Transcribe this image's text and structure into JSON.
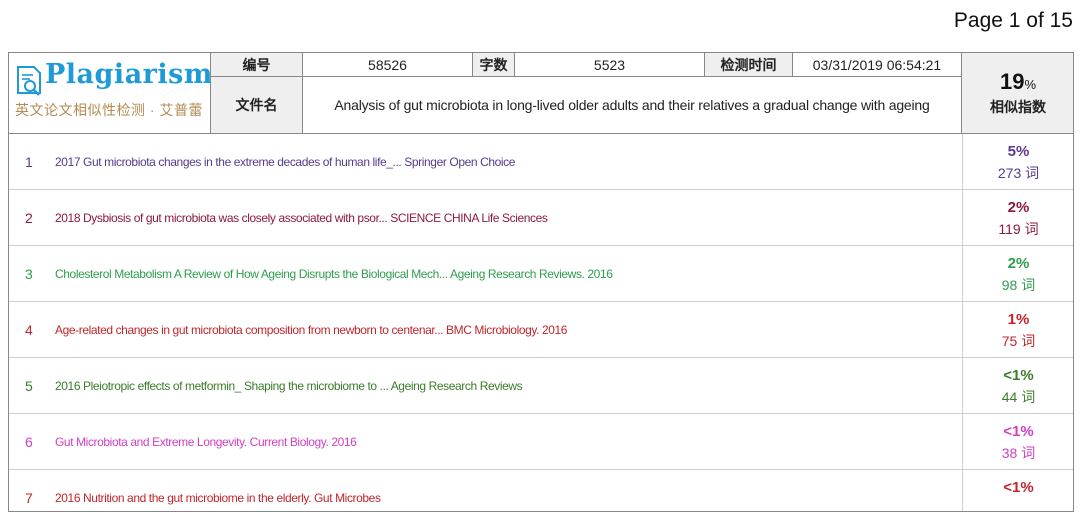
{
  "page_label": "Page 1 of 15",
  "logo": {
    "title": "Plagiarism",
    "subtitle": "英文论文相似性检测 · 艾普蕾"
  },
  "header": {
    "id_label": "编号",
    "id_value": "58526",
    "words_label": "字数",
    "words_value": "5523",
    "time_label": "检测时间",
    "time_value": "03/31/2019 06:54:21",
    "file_label": "文件名",
    "file_value": "Analysis of gut microbiota in long-lived older adults and their relatives a gradual change with ageing",
    "score_value": "19",
    "score_unit": "%",
    "score_label": "相似指数"
  },
  "results": [
    {
      "rank": "1",
      "title": "2017 Gut microbiota changes in the extreme decades of human life_... Springer Open Choice",
      "percent": "5%",
      "words": "273 词",
      "color": "#5a3a8c"
    },
    {
      "rank": "2",
      "title": "2018 Dysbiosis of gut microbiota was closely associated with psor... SCIENCE CHINA Life Sciences",
      "percent": "2%",
      "words": "119 词",
      "color": "#8b1a3c"
    },
    {
      "rank": "3",
      "title": "Cholesterol Metabolism A Review of How Ageing Disrupts the Biological Mech... Ageing Research Reviews. 2016",
      "percent": "2%",
      "words": "98 词",
      "color": "#2e9e4e"
    },
    {
      "rank": "4",
      "title": "Age-related changes in gut microbiota composition from newborn to centenar... BMC Microbiology. 2016",
      "percent": "1%",
      "words": "75 词",
      "color": "#c0262c"
    },
    {
      "rank": "5",
      "title": "2016 Pleiotropic effects of metformin_ Shaping the microbiome to ... Ageing Research Reviews",
      "percent": "<1%",
      "words": "44 词",
      "color": "#3a7d2a"
    },
    {
      "rank": "6",
      "title": "Gut Microbiota and Extreme Longevity. Current Biology. 2016",
      "percent": "<1%",
      "words": "38 词",
      "color": "#d23fc2"
    },
    {
      "rank": "7",
      "title": "2016 Nutrition and the gut microbiome in the elderly. Gut Microbes",
      "percent": "<1%",
      "words": "",
      "color": "#c0262c"
    }
  ]
}
